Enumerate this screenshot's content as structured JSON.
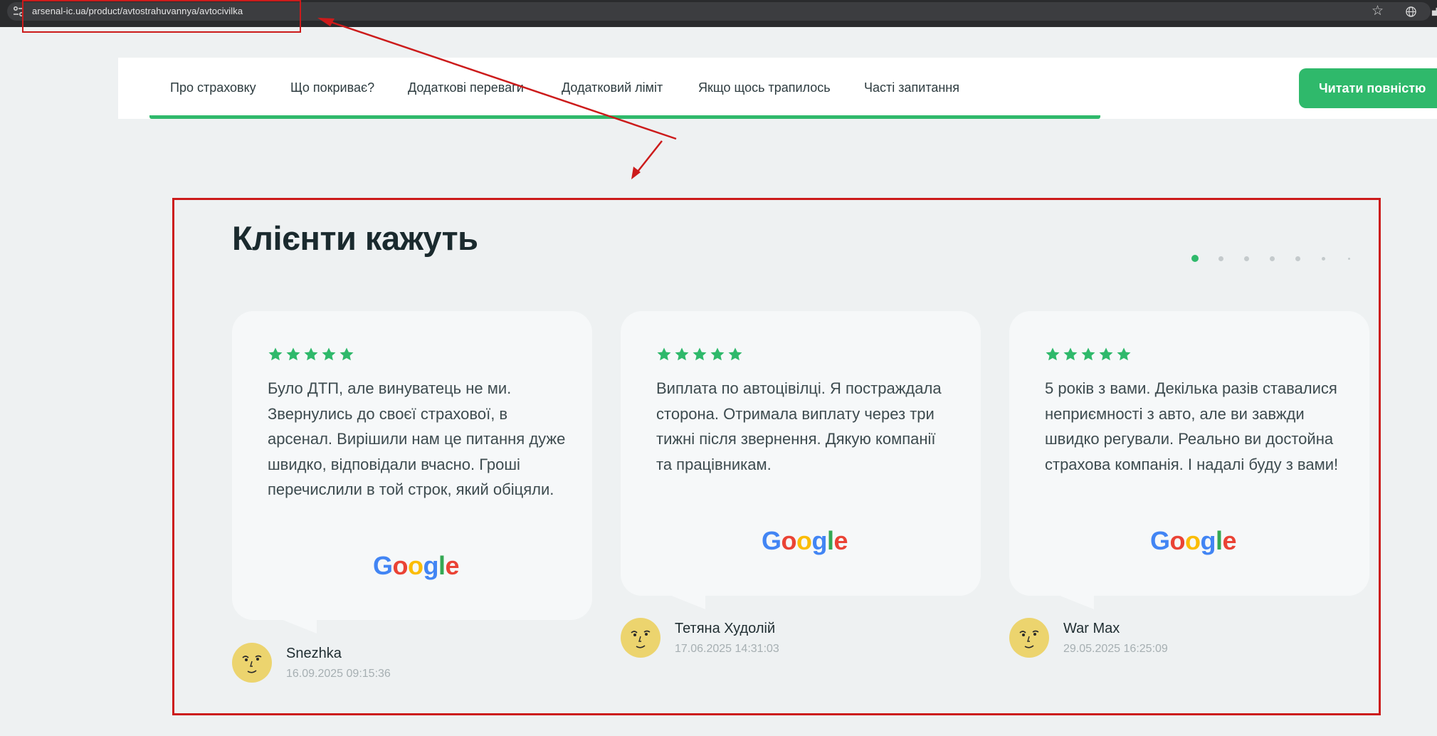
{
  "browser": {
    "url": "arsenal-ic.ua/product/avtostrahuvannya/avtocivilka",
    "icons": [
      "tune-icon",
      "bookmark-star-icon",
      "globe-icon",
      "extension-icon"
    ]
  },
  "nav": {
    "items": [
      {
        "label": "Про страховку"
      },
      {
        "label": "Що покриває?"
      },
      {
        "label": "Додаткові переваги"
      },
      {
        "label": "Додатковий ліміт"
      },
      {
        "label": "Якщо щось трапилось"
      },
      {
        "label": "Часті запитання"
      }
    ],
    "cta_label": "Читати повністю"
  },
  "reviews_section": {
    "title": "Клієнти кажуть",
    "pagination": {
      "total": 7,
      "active": 1
    },
    "reviews": [
      {
        "rating": 5,
        "text": "Було ДТП, але винуватець не ми. Звернулись до своєї страхової, в арсенал. Вирішили нам це питання дуже швидко, відповідали вчасно. Гроші перечислили в той строк, який обіцяли.",
        "source": "Google",
        "author": "Snezhka",
        "date": "16.09.2025 09:15:36"
      },
      {
        "rating": 5,
        "text": "Виплата по автоцівілці. Я постраждала сторона. Отримала виплату через три тижні після звернення. Дякую компанії та працівникам.",
        "source": "Google",
        "author": "Тетяна Худолій",
        "date": "17.06.2025 14:31:03"
      },
      {
        "rating": 5,
        "text": "5 років з вами. Декілька разів ставалися неприємності з авто, але ви завжди швидко регували. Реально ви достойна страхова компанія. І надалі буду з вами!",
        "source": "Google",
        "author": "War Max",
        "date": "29.05.2025 16:25:09"
      }
    ]
  },
  "colors": {
    "accent_green": "#2fb96b",
    "annotation_red": "#cc1b1b",
    "page_bg": "#eef1f2",
    "card_bg": "#f6f8f9",
    "avatar_yellow": "#ecd46e"
  }
}
